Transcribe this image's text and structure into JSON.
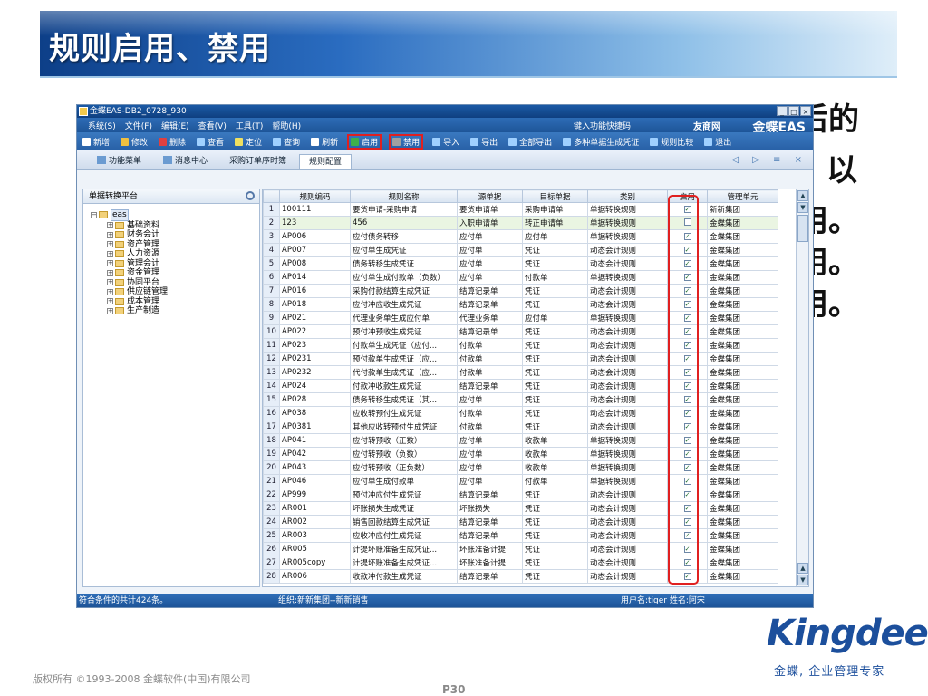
{
  "slide": {
    "title": "规则启用、禁用",
    "bg_lines": [
      {
        "text": "启用、禁用",
        "hidden": true
      },
      {
        "text": "后的",
        "visible_part": true
      },
      {
        "text": "以"
      },
      {
        "text": "用。"
      },
      {
        "text": "用。"
      },
      {
        "text": "用。"
      }
    ],
    "copyright": "版权所有 ©1993-2008 金蝶软件(中国)有限公司",
    "page_number": "P30",
    "logo_text": "Kingdee",
    "tagline": "金蝶, 企业管理专家"
  },
  "window": {
    "title": "金蝶EAS-DB2_0728_930",
    "controls": [
      "_",
      "□",
      "×"
    ],
    "menus": [
      "系统(S)",
      "文件(F)",
      "编辑(E)",
      "查看(V)",
      "工具(T)",
      "帮助(H)"
    ],
    "quick_search": "键入功能快捷码",
    "brand_mini": "友商网",
    "brand": "金蝶EAS"
  },
  "toolbar": {
    "items": [
      {
        "label": "新增",
        "color": "#ffffff"
      },
      {
        "label": "修改",
        "color": "#f0c040"
      },
      {
        "label": "删除",
        "color": "#e04040"
      },
      {
        "label": "查看",
        "color": "#9fd0ff"
      },
      {
        "label": "定位",
        "color": "#f0e060"
      },
      {
        "label": "查询",
        "color": "#9fd0ff"
      },
      {
        "label": "刷新",
        "color": "#ffffff"
      },
      {
        "label": "启用",
        "color": "#3fb04a",
        "highlight": true
      },
      {
        "label": "禁用",
        "color": "#a0a0a0",
        "highlight": true
      },
      {
        "label": "导入",
        "color": "#9fd0ff"
      },
      {
        "label": "导出",
        "color": "#9fd0ff"
      },
      {
        "label": "全部导出",
        "color": "#9fd0ff"
      },
      {
        "label": "多种单据生成凭证",
        "color": "#9fd0ff"
      },
      {
        "label": "规则比较",
        "color": "#9fd0ff"
      },
      {
        "label": "退出",
        "color": "#9fd0ff"
      }
    ]
  },
  "tabs": [
    {
      "label": "功能菜单",
      "active": false
    },
    {
      "label": "消息中心",
      "active": false
    },
    {
      "label": "采购订单序时簿",
      "active": false
    },
    {
      "label": "规则配置",
      "active": true
    }
  ],
  "tab_nav": "◁ ▷ ≡ ×",
  "tree": {
    "header": "单据转换平台",
    "root": "eas",
    "nodes": [
      "基础资料",
      "财务会计",
      "资产管理",
      "人力资源",
      "管理会计",
      "资金管理",
      "协同平台",
      "供应链管理",
      "成本管理",
      "生产制造"
    ]
  },
  "grid": {
    "columns": [
      "规则编码",
      "规则名称",
      "源单据",
      "目标单据",
      "类别",
      "启用",
      "管理单元"
    ],
    "rows": [
      [
        "100111",
        "要货申请-采购申请",
        "要货申请单",
        "采购申请单",
        "单据转换规则",
        "1",
        "新新集团"
      ],
      [
        "123",
        "456",
        "入职申请单",
        "转正申请单",
        "单据转换规则",
        "0",
        "金蝶集团"
      ],
      [
        "AP006",
        "应付债务转移",
        "应付单",
        "应付单",
        "单据转换规则",
        "1",
        "金蝶集团"
      ],
      [
        "AP007",
        "应付单生成凭证",
        "应付单",
        "凭证",
        "动态会计规则",
        "1",
        "金蝶集团"
      ],
      [
        "AP008",
        "债务转移生成凭证",
        "应付单",
        "凭证",
        "动态会计规则",
        "1",
        "金蝶集团"
      ],
      [
        "AP014",
        "应付单生成付款单（负数）",
        "应付单",
        "付款单",
        "单据转换规则",
        "1",
        "金蝶集团"
      ],
      [
        "AP016",
        "采购付款结算生成凭证",
        "结算记录单",
        "凭证",
        "动态会计规则",
        "1",
        "金蝶集团"
      ],
      [
        "AP018",
        "应付冲应收生成凭证",
        "结算记录单",
        "凭证",
        "动态会计规则",
        "1",
        "金蝶集团"
      ],
      [
        "AP021",
        "代理业务单生成应付单",
        "代理业务单",
        "应付单",
        "单据转换规则",
        "1",
        "金蝶集团"
      ],
      [
        "AP022",
        "预付冲预收生成凭证",
        "结算记录单",
        "凭证",
        "动态会计规则",
        "1",
        "金蝶集团"
      ],
      [
        "AP023",
        "付款单生成凭证（应付...",
        "付款单",
        "凭证",
        "动态会计规则",
        "1",
        "金蝶集团"
      ],
      [
        "AP0231",
        "预付款单生成凭证（应...",
        "付款单",
        "凭证",
        "动态会计规则",
        "1",
        "金蝶集团"
      ],
      [
        "AP0232",
        "代付款单生成凭证（应...",
        "付款单",
        "凭证",
        "动态会计规则",
        "1",
        "金蝶集团"
      ],
      [
        "AP024",
        "付款冲收款生成凭证",
        "结算记录单",
        "凭证",
        "动态会计规则",
        "1",
        "金蝶集团"
      ],
      [
        "AP028",
        "债务转移生成凭证（其...",
        "应付单",
        "凭证",
        "动态会计规则",
        "1",
        "金蝶集团"
      ],
      [
        "AP038",
        "应收转预付生成凭证",
        "付款单",
        "凭证",
        "动态会计规则",
        "1",
        "金蝶集团"
      ],
      [
        "AP0381",
        "其他应收转预付生成凭证",
        "付款单",
        "凭证",
        "动态会计规则",
        "1",
        "金蝶集团"
      ],
      [
        "AP041",
        "应付转预收（正数）",
        "应付单",
        "收款单",
        "单据转换规则",
        "1",
        "金蝶集团"
      ],
      [
        "AP042",
        "应付转预收（负数）",
        "应付单",
        "收款单",
        "单据转换规则",
        "1",
        "金蝶集团"
      ],
      [
        "AP043",
        "应付转预收（正负数）",
        "应付单",
        "收款单",
        "单据转换规则",
        "1",
        "金蝶集团"
      ],
      [
        "AP046",
        "应付单生成付款单",
        "应付单",
        "付款单",
        "单据转换规则",
        "1",
        "金蝶集团"
      ],
      [
        "AP999",
        "预付冲应付生成凭证",
        "结算记录单",
        "凭证",
        "动态会计规则",
        "1",
        "金蝶集团"
      ],
      [
        "AR001",
        "坏账损失生成凭证",
        "坏账损失",
        "凭证",
        "动态会计规则",
        "1",
        "金蝶集团"
      ],
      [
        "AR002",
        "销售回款结算生成凭证",
        "结算记录单",
        "凭证",
        "动态会计规则",
        "1",
        "金蝶集团"
      ],
      [
        "AR003",
        "应收冲应付生成凭证",
        "结算记录单",
        "凭证",
        "动态会计规则",
        "1",
        "金蝶集团"
      ],
      [
        "AR005",
        "计提坏账准备生成凭证...",
        "坏账准备计提",
        "凭证",
        "动态会计规则",
        "1",
        "金蝶集团"
      ],
      [
        "AR005copy",
        "计提坏账准备生成凭证...",
        "坏账准备计提",
        "凭证",
        "动态会计规则",
        "1",
        "金蝶集团"
      ],
      [
        "AR006",
        "收款冲付款生成凭证",
        "结算记录单",
        "凭证",
        "动态会计规则",
        "1",
        "金蝶集团"
      ]
    ]
  },
  "status": {
    "count": "符合条件的共计424条。",
    "org": "组织:新新集团--新新销售",
    "user": "用户名:tiger 姓名:阿宋"
  }
}
